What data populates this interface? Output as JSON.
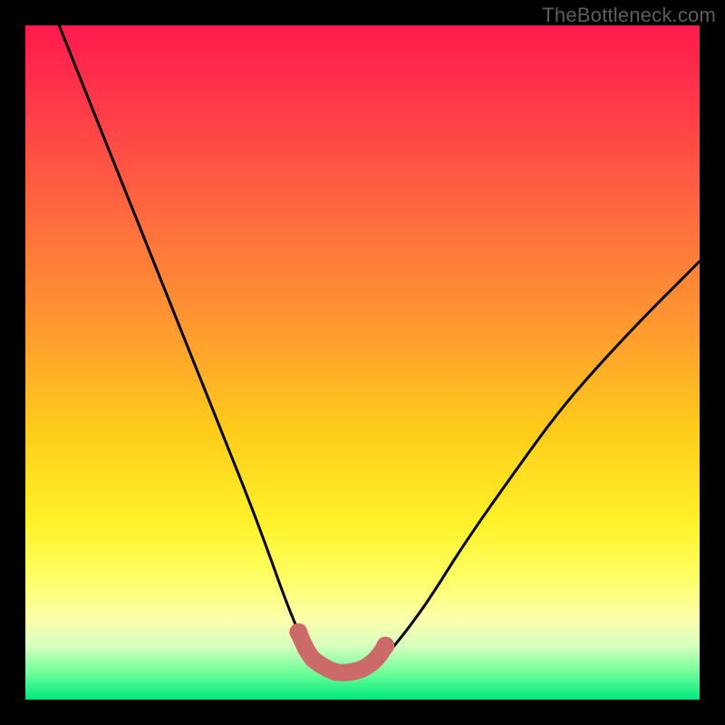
{
  "watermark": "TheBottleneck.com",
  "chart_data": {
    "type": "line",
    "title": "",
    "xlabel": "",
    "ylabel": "",
    "xlim": [
      0,
      100
    ],
    "ylim": [
      0,
      100
    ],
    "series": [
      {
        "name": "black-curve",
        "x": [
          5,
          9,
          13,
          17,
          21,
          25,
          29,
          33,
          36,
          38.5,
          40.5,
          42.5,
          44,
          46,
          48,
          50.5,
          53,
          56,
          60,
          65,
          72,
          80,
          90,
          100
        ],
        "y": [
          100,
          90,
          80,
          70,
          60,
          50,
          40,
          30,
          22,
          15,
          10,
          6.5,
          5,
          4,
          4,
          4.5,
          6,
          9.5,
          15,
          23,
          33,
          44,
          55,
          65
        ]
      },
      {
        "name": "pink-marker-segment",
        "x": [
          40.5,
          41.6,
          42.6,
          44,
          46,
          48,
          50,
          51.5,
          52.6,
          53.4
        ],
        "y": [
          10,
          7.5,
          6,
          5,
          4,
          4,
          4.5,
          5.5,
          6.7,
          8
        ]
      }
    ],
    "gradient_background": {
      "top_color": "#ff1a4d",
      "bottom_color": "#00e87e",
      "description": "vertical smooth gradient red-pink to orange to yellow to green"
    }
  }
}
